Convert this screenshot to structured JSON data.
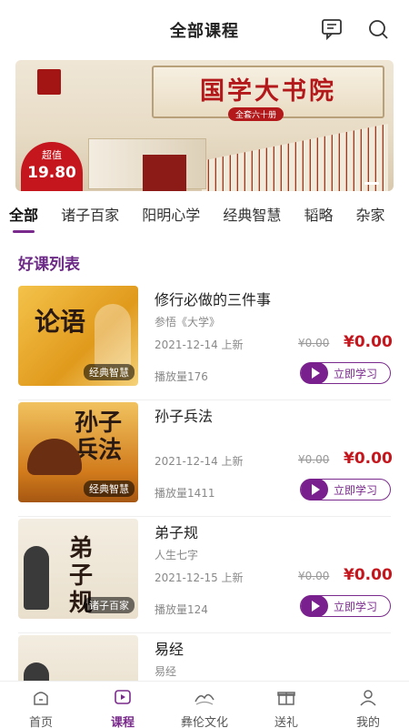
{
  "header": {
    "title": "全部课程",
    "message_icon": "message-icon",
    "search_icon": "search-icon"
  },
  "banner": {
    "title": "国学大书院",
    "subtitle": "全套六十册",
    "badge_line1": "超值",
    "badge_price": "19.80"
  },
  "tabs": [
    {
      "label": "全部",
      "active": true
    },
    {
      "label": "诸子百家"
    },
    {
      "label": "阳明心学"
    },
    {
      "label": "经典智慧"
    },
    {
      "label": "韬略"
    },
    {
      "label": "杂家"
    }
  ],
  "section_title": "好课列表",
  "courses": [
    {
      "title": "修行必做的三件事",
      "subtitle": "参悟《大学》",
      "date": "2021-12-14 上新",
      "old_price": "¥0.00",
      "price": "¥0.00",
      "plays": "播放量176",
      "tag": "经典智慧",
      "cover_text": "论语",
      "button": "立即学习"
    },
    {
      "title": "孙子兵法",
      "subtitle": "",
      "date": "2021-12-14 上新",
      "old_price": "¥0.00",
      "price": "¥0.00",
      "plays": "播放量1411",
      "tag": "经典智慧",
      "cover_text": "孙子兵法",
      "button": "立即学习"
    },
    {
      "title": "弟子规",
      "subtitle": "人生七字",
      "date": "2021-12-15 上新",
      "old_price": "¥0.00",
      "price": "¥0.00",
      "plays": "播放量124",
      "tag": "诸子百家",
      "cover_text": "弟子规",
      "button": "立即学习"
    },
    {
      "title": "易经",
      "subtitle": "易经",
      "date": "",
      "old_price": "",
      "price": "",
      "plays": "",
      "tag": "",
      "cover_text": "",
      "button": ""
    }
  ],
  "nav": [
    {
      "label": "首页",
      "icon": "home-icon"
    },
    {
      "label": "课程",
      "icon": "course-play-icon",
      "active": true
    },
    {
      "label": "彝伦文化",
      "icon": "mountain-logo-icon"
    },
    {
      "label": "送礼",
      "icon": "gift-icon"
    },
    {
      "label": "我的",
      "icon": "profile-icon"
    }
  ],
  "colors": {
    "accent": "#7a2a8c",
    "price": "#c4161c"
  }
}
